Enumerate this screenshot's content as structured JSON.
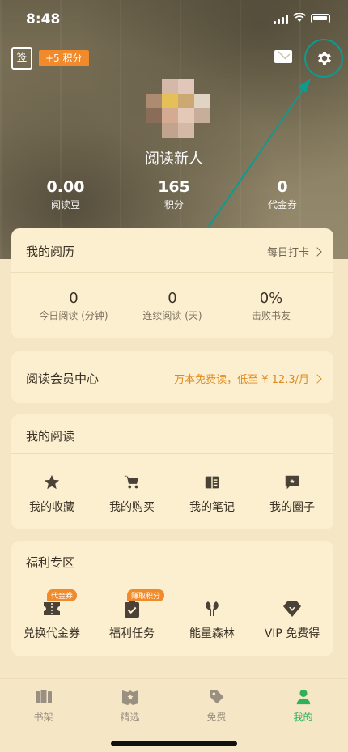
{
  "status_bar": {
    "time": "8:48"
  },
  "header": {
    "signin_label": "签",
    "points_badge": "+5 积分",
    "mail_icon": "mail-icon",
    "settings_icon": "gear-icon",
    "annotation_color": "#0f9a8e"
  },
  "profile": {
    "username": "阅读新人",
    "stats": [
      {
        "value": "0.00",
        "label": "阅读豆"
      },
      {
        "value": "165",
        "label": "积分"
      },
      {
        "value": "0",
        "label": "代金券"
      }
    ]
  },
  "reading_history": {
    "title": "我的阅历",
    "link": "每日打卡",
    "stats": [
      {
        "value": "0",
        "label": "今日阅读 (分钟)"
      },
      {
        "value": "0",
        "label": "连续阅读 (天)"
      },
      {
        "value": "0%",
        "label": "击败书友"
      }
    ]
  },
  "member_center": {
    "title": "阅读会员中心",
    "link": "万本免费读，低至 ¥ 12.3/月"
  },
  "my_reading": {
    "title": "我的阅读",
    "items": [
      {
        "label": "我的收藏",
        "icon": "star-icon"
      },
      {
        "label": "我的购买",
        "icon": "cart-icon"
      },
      {
        "label": "我的笔记",
        "icon": "notebook-icon"
      },
      {
        "label": "我的圈子",
        "icon": "chat-bubble-icon"
      }
    ]
  },
  "welfare": {
    "title": "福利专区",
    "items": [
      {
        "label": "兑换代金券",
        "icon": "ticket-icon",
        "tag": "代金券"
      },
      {
        "label": "福利任务",
        "icon": "clipboard-check-icon",
        "tag": "赚取积分"
      },
      {
        "label": "能量森林",
        "icon": "tree-icon",
        "tag": ""
      },
      {
        "label": "VIP 免费得",
        "icon": "diamond-icon",
        "tag": ""
      }
    ]
  },
  "tabbar": {
    "tabs": [
      {
        "label": "书架",
        "icon": "bookshelf-icon"
      },
      {
        "label": "精选",
        "icon": "featured-icon"
      },
      {
        "label": "免费",
        "icon": "tag-icon"
      },
      {
        "label": "我的",
        "icon": "person-icon",
        "active": true
      }
    ],
    "active_color": "#2fb15a"
  },
  "accent_color": "#f08a2a"
}
